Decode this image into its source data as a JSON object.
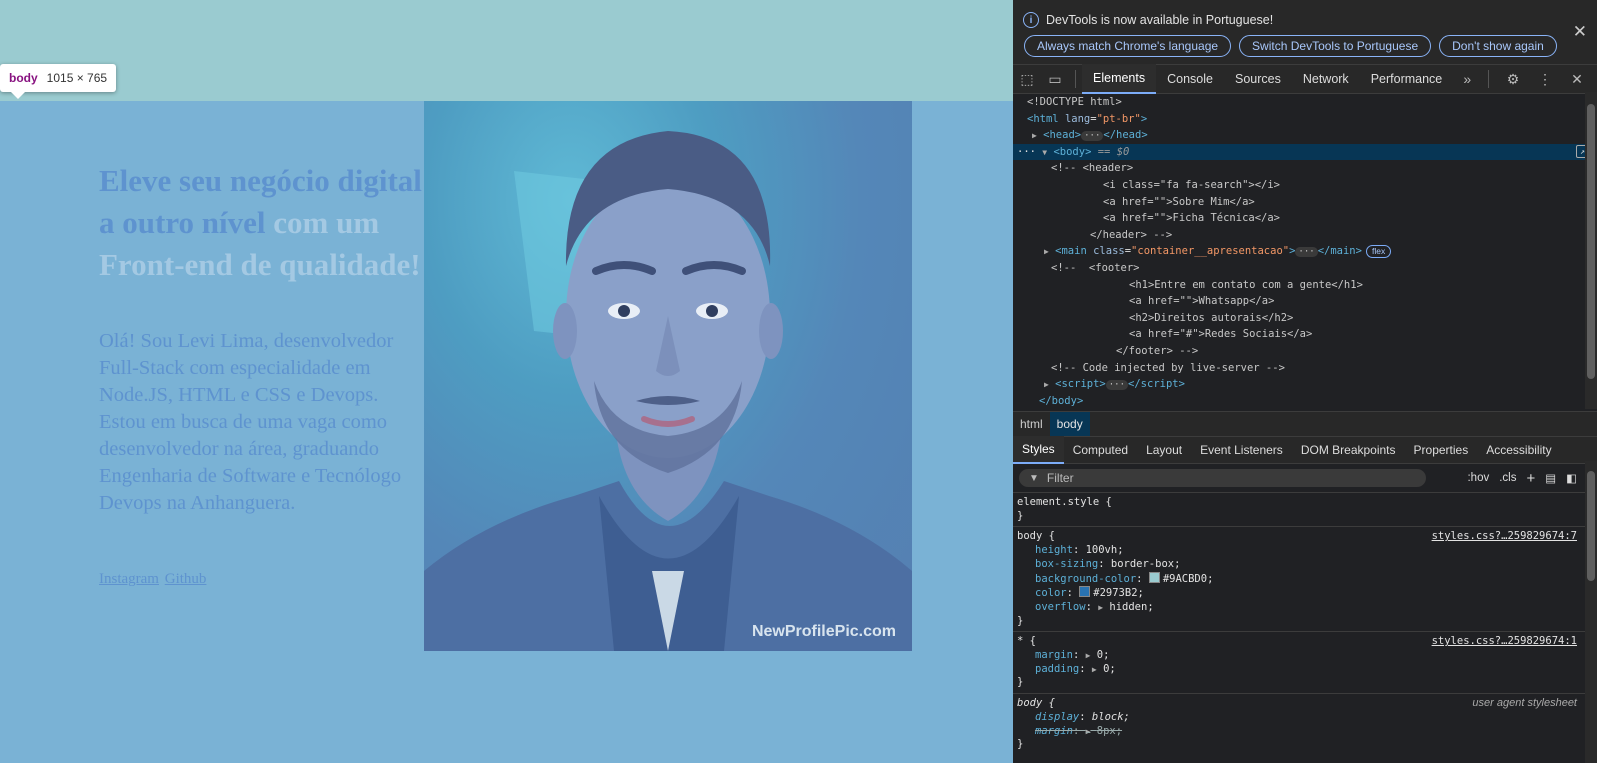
{
  "page": {
    "tooltip": {
      "tag": "body",
      "dims": "1015 × 765"
    },
    "hero": {
      "title_part1": "Eleve seu negócio digital a outro nível",
      "title_part2": "com um Front-end de qualidade!",
      "text": "Olá! Sou Levi Lima, desenvolvedor Full-Stack com especialidade em Node.JS, HTML e CSS e Devops. Estou em busca de uma vaga como desenvolvedor na área, graduando Engenharia de Software e Tecnólogo Devops na Anhanguera.",
      "links": [
        "Instagram",
        "Github"
      ]
    },
    "profile": {
      "watermark": "NewProfilePic.com"
    },
    "colors": {
      "background": "#9ACBD0",
      "text": "#2973B2",
      "overlay": "#7AB2D5"
    }
  },
  "devtools": {
    "infobar": {
      "message": "DevTools is now available in Portuguese!",
      "buttons": [
        "Always match Chrome's language",
        "Switch DevTools to Portuguese",
        "Don't show again"
      ]
    },
    "tabs": [
      "Elements",
      "Console",
      "Sources",
      "Network",
      "Performance"
    ],
    "active_tab": "Elements",
    "dom": {
      "doctype": "<!DOCTYPE html>",
      "html_open": "html",
      "lang_attr": "lang",
      "lang_val": "\"pt-br\"",
      "head": "head",
      "body": "body",
      "body_eq": " == $0",
      "c1": "<!-- <header>",
      "c2": "<i class=\"fa fa-search\"></i>",
      "c3": "<a href=\"\">Sobre Mim</a>",
      "c4": "<a href=\"\">Ficha Técnica</a>",
      "c5": "</header> -->",
      "main_tag": "main",
      "main_attr": "class",
      "main_val": "\"container__apresentacao\"",
      "main_badge": "flex",
      "f1": "<!--  <footer>",
      "f2": "<h1>Entre em contato com a gente</h1>",
      "f3": "<a href=\"\">Whatsapp</a>",
      "f4": "<h2>Direitos autorais</h2>",
      "f5": "<a href=\"#\">Redes Sociais</a>",
      "f6": "</footer> -->",
      "live": "<!-- Code injected by live-server -->",
      "script": "script",
      "body_close": "body"
    },
    "breadcrumbs": [
      "html",
      "body"
    ],
    "subtabs": [
      "Styles",
      "Computed",
      "Layout",
      "Event Listeners",
      "DOM Breakpoints",
      "Properties",
      "Accessibility"
    ],
    "filter_placeholder": "Filter",
    "filter_tools": {
      "hov": ":hov",
      "cls": ".cls"
    },
    "styles": {
      "element_style": "element.style {",
      "rule1": {
        "selector": "body {",
        "source": "styles.css?…259829674:7",
        "decls": [
          {
            "p": "height",
            "v": "100vh;"
          },
          {
            "p": "box-sizing",
            "v": "border-box;"
          },
          {
            "p": "background-color",
            "v": "#9ACBD0;",
            "swatch": "#9ACBD0"
          },
          {
            "p": "color",
            "v": "#2973B2;",
            "swatch": "#2973B2"
          },
          {
            "p": "overflow",
            "v": "hidden;"
          }
        ]
      },
      "rule2": {
        "selector": "* {",
        "source": "styles.css?…259829674:1",
        "decls": [
          {
            "p": "margin",
            "v": "0;"
          },
          {
            "p": "padding",
            "v": "0;"
          }
        ]
      },
      "rule3": {
        "selector": "body {",
        "source": "user agent stylesheet",
        "decls": [
          {
            "p": "display",
            "v": "block;"
          },
          {
            "p": "margin",
            "v": "8px;"
          }
        ]
      },
      "close": "}"
    }
  }
}
